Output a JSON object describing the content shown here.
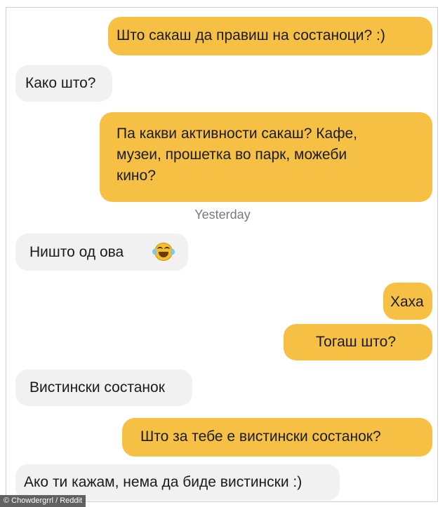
{
  "conversation": {
    "messages": [
      {
        "side": "sent",
        "text": "Што сакаш да правиш на состаноци? :)"
      },
      {
        "side": "received",
        "text": "Како што?"
      },
      {
        "side": "sent",
        "text": "Па какви активности сакаш? Кафе,\nмузеи, прошетка во парк, можеби\nкино?"
      },
      {
        "side": "received",
        "text": "Ништо од ова",
        "emoji": "face-with-tears-of-joy-icon"
      },
      {
        "side": "sent",
        "text": "Хаха"
      },
      {
        "side": "sent",
        "text": "Тогаш што?"
      },
      {
        "side": "received",
        "text": "Вистински состанок"
      },
      {
        "side": "sent",
        "text": "Што за тебе е вистински состанок?"
      },
      {
        "side": "received",
        "text": "Ако ти кажам, нема да биде вистински :)"
      }
    ],
    "timestamp": "Yesterday"
  },
  "watermark": "© Chowdergrrl / Reddit",
  "colors": {
    "sent_bubble": "#f5c043",
    "received_bubble": "#f1f1f1"
  }
}
